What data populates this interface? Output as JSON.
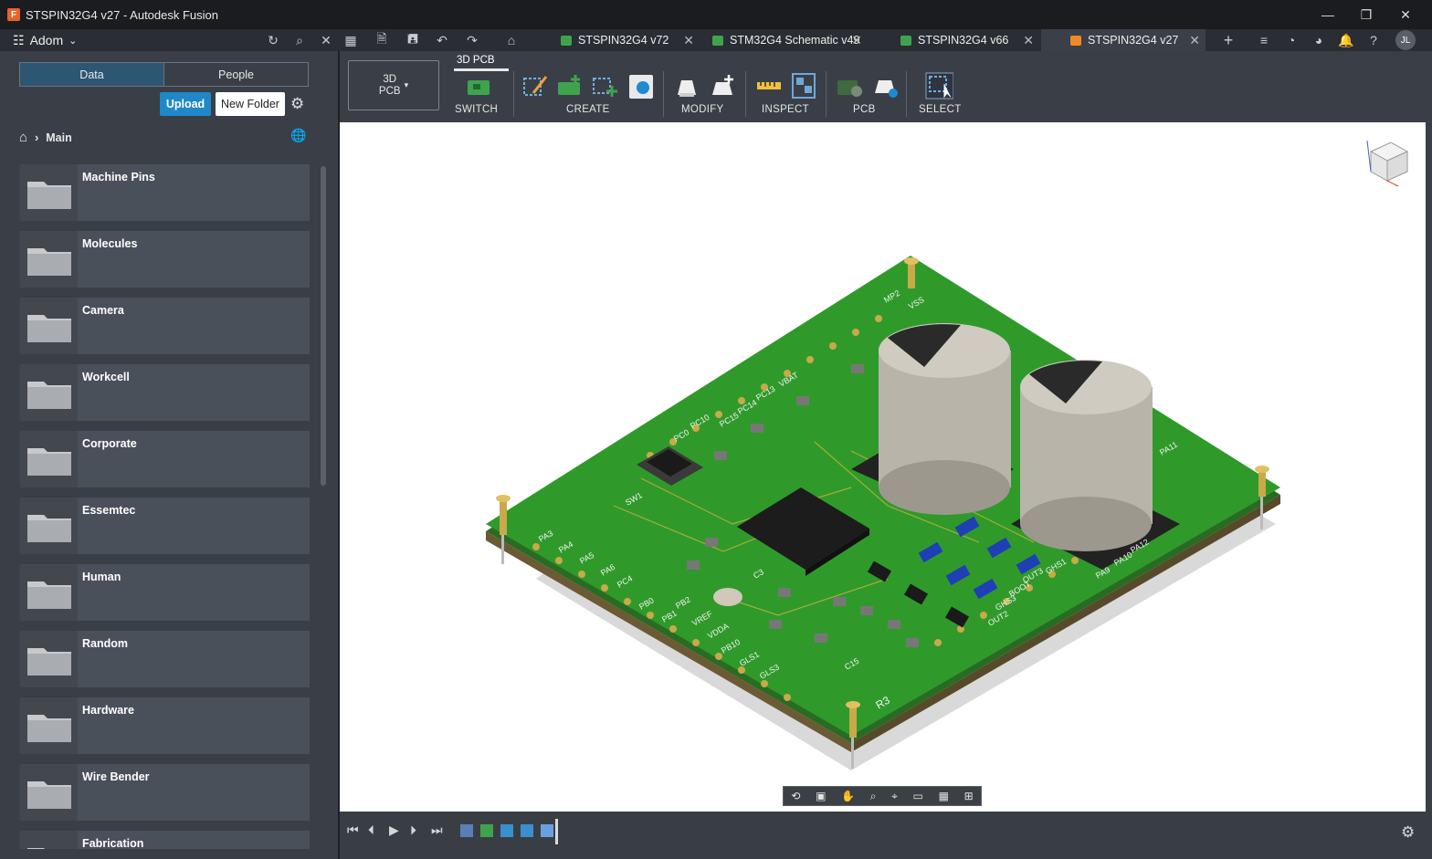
{
  "window": {
    "title": "STSPIN32G4 v27 - Autodesk Fusion",
    "minimize": "—",
    "maximize": "❐",
    "close": "✕"
  },
  "topbar": {
    "team": "Adom",
    "avatar": "JL",
    "tabs": [
      {
        "label": "STSPIN32G4 v72",
        "color": "#3fa34d"
      },
      {
        "label": "STM32G4 Schematic v49",
        "color": "#3fa34d"
      },
      {
        "label": "STSPIN32G4 v66",
        "color": "#3fa34d"
      },
      {
        "label": "STSPIN32G4 v27",
        "color": "#f08a24"
      }
    ]
  },
  "left_panel": {
    "tab_data": "Data",
    "tab_people": "People",
    "upload": "Upload",
    "new_folder": "New Folder",
    "breadcrumb": "Main",
    "folders": [
      "Machine Pins",
      "Molecules",
      "Camera",
      "Workcell",
      "Corporate",
      "Essemtec",
      "Human",
      "Random",
      "Hardware",
      "Wire Bender",
      "Fabrication"
    ]
  },
  "ribbon": {
    "workspace": "3D\nPCB",
    "active_tab": "3D PCB",
    "groups": [
      "SWITCH",
      "CREATE",
      "MODIFY",
      "INSPECT",
      "PCB",
      "SELECT"
    ]
  },
  "board_labels": {
    "components": [
      "SW1",
      "R3",
      "C3",
      "C15"
    ],
    "pins": [
      "PA3",
      "PA4",
      "PA5",
      "PA6",
      "PC4",
      "PB0",
      "PB1",
      "PB2",
      "VREF",
      "VDDA",
      "PB10",
      "GLS1",
      "GLS3",
      "VSS",
      "MP2",
      "VBAT",
      "PC13",
      "PC14",
      "PC15",
      "PC0",
      "PC10",
      "BOOT",
      "OUT3",
      "OUT2",
      "GHS1",
      "GHS3",
      "PA11",
      "PA12",
      "PA9",
      "PA10"
    ]
  },
  "colors": {
    "board": "#2f9a2a",
    "accent": "#1e88c9",
    "viewport": "#ffffff"
  }
}
